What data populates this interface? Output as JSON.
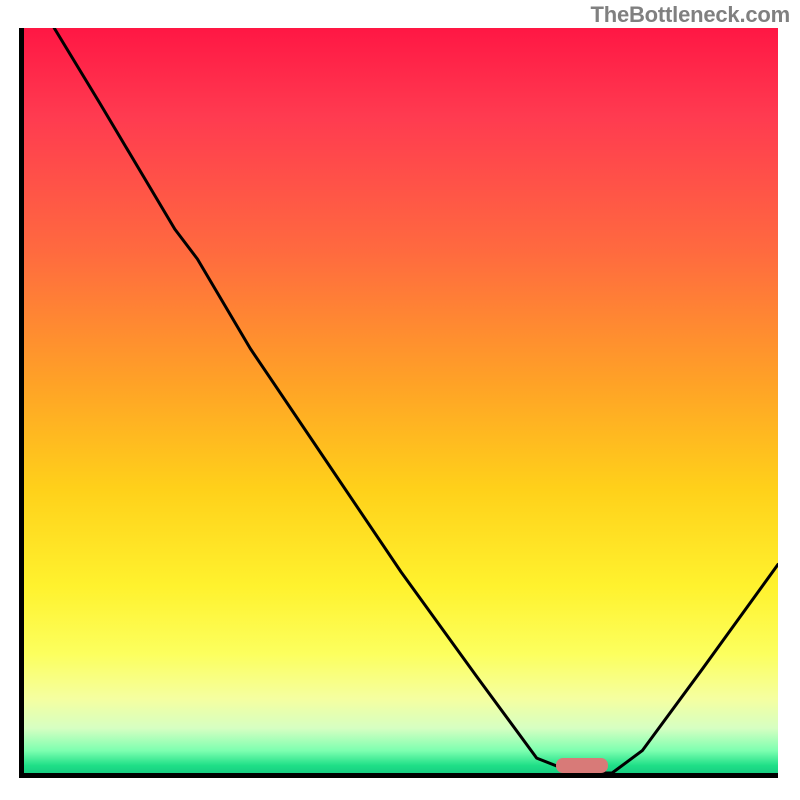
{
  "watermark": "TheBottleneck.com",
  "chart_data": {
    "type": "line",
    "title": "",
    "xlabel": "",
    "ylabel": "",
    "xlim": [
      0,
      100
    ],
    "ylim": [
      0,
      100
    ],
    "grid": false,
    "background_gradient": {
      "direction": "vertical",
      "stops": [
        {
          "offset": 0.0,
          "color": "#ff1744"
        },
        {
          "offset": 0.3,
          "color": "#ff6a3f"
        },
        {
          "offset": 0.48,
          "color": "#ffa326"
        },
        {
          "offset": 0.75,
          "color": "#fff22e"
        },
        {
          "offset": 0.94,
          "color": "#d6ffc2"
        },
        {
          "offset": 1.0,
          "color": "#18cf82"
        }
      ]
    },
    "series": [
      {
        "name": "bottleneck-curve",
        "x": [
          4,
          10,
          20,
          23,
          30,
          40,
          50,
          60,
          68,
          73,
          78,
          82,
          90,
          100
        ],
        "y": [
          100,
          90,
          73,
          69,
          57,
          42,
          27,
          13,
          2,
          0,
          0,
          3,
          14,
          28
        ]
      }
    ],
    "marker": {
      "name": "optimal-range",
      "x": 74,
      "y": 0,
      "width": 7,
      "height": 2,
      "color": "#d87a78"
    }
  }
}
